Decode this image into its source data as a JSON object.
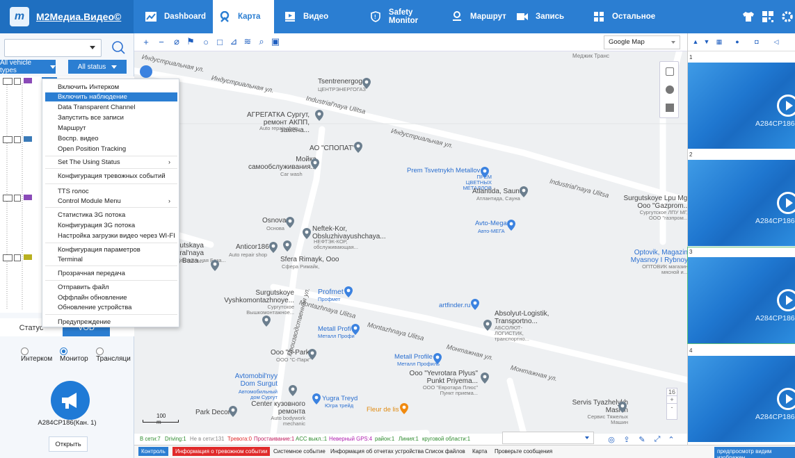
{
  "app": {
    "title": "M2Медиа.Видео©",
    "logo_letter": "m"
  },
  "nav": [
    {
      "label": "Dashboard",
      "icon": "chart-icon"
    },
    {
      "label": "Карта",
      "icon": "map-pin-icon",
      "active": true
    },
    {
      "label": "Видео",
      "icon": "play-icon"
    },
    {
      "label": "Safety Monitor",
      "icon": "shield-icon"
    },
    {
      "label": "Маршрут",
      "icon": "route-icon"
    },
    {
      "label": "Запись",
      "icon": "camera-icon"
    },
    {
      "label": "Остальное",
      "icon": "grid-icon"
    }
  ],
  "colors": {
    "primary": "#2b7ed2",
    "alarm": "#e02a2a",
    "map_bg": "#eef0f2"
  },
  "left": {
    "filter_type": "All vehicle types",
    "filter_status": "All status",
    "tab_status": "Статус",
    "tab_vod": "VOD",
    "radio_intercom": "Интерком",
    "radio_monitor": "Монитор",
    "radio_broadcast": "Трансляци",
    "mic_label": "A284CP186(Кан. 1)",
    "open_button": "Открыть"
  },
  "context_menu": [
    "Включить Интерком",
    "Включить наблюдение",
    "Data Transparent Channel",
    "Запустить все записи",
    "Маршрут",
    "Воспр. видео",
    "Open Position Tracking",
    "Set The Using Status",
    "Конфигурация тревожных событий",
    "TTS голос",
    "Control Module Menu",
    "Статистика 3G потока",
    "Конфигурация 3G потока",
    "Настройка загрузки видео через WI-FI",
    "Конфигурация параметров",
    "Terminal",
    "Прозрачная передача",
    "Отправить файл",
    "Оффлайн обновление",
    "Обновление устройства",
    "Предупреждение"
  ],
  "map": {
    "provider": "Google Map",
    "scale": "100 m",
    "roads": [
      "Индустриальная ул.",
      "Industrial'naya Ulitsa",
      "Индустриальная ул.",
      "Industrial'naya Ulitsa",
      "Монтажная ул.",
      "Montazhnaya Ulitsa",
      "Montazhnaya Ulitsa",
      "Монтажная ул.",
      "Монтажная ул.",
      "Производственная ул."
    ],
    "places": [
      {
        "name": "Tsentrenergogaz",
        "sub": "ЦЕНТРЭНЕРГОГАЗ"
      },
      {
        "name": "АГРЕГАТКА Сургут, ремонт АКПП, замена...",
        "sub": "Auto repair shop"
      },
      {
        "name": "АО \"СПОПАТ\"",
        "sub": ""
      },
      {
        "name": "Мойка самообслуживания...",
        "sub": "Car wash"
      },
      {
        "name": "Prem Tsvetnykh Metallov",
        "sub": "ПРЕМ ЦВЕТНЫХ МЕТАЛЛОВ"
      },
      {
        "name": "Atlantida, Sauna",
        "sub": "Атлантида, Сауна"
      },
      {
        "name": "Surgutskoye Lpu Mg, Ooo \"Gazprom...",
        "sub": "Сургутское ЛПУ МГ, ООО \"газпром..."
      },
      {
        "name": "Osnova",
        "sub": "Основа"
      },
      {
        "name": "Neftek-Kor, Obsluzhivayushchaya...",
        "sub": "НЕФТЭК-КОР, обслуживающая..."
      },
      {
        "name": "Avto-Mega",
        "sub": "Авто-МЕГА"
      },
      {
        "name": "Surgutskaya Tsentral'naya Baza...",
        "sub": "Сургутская Центральная База..."
      },
      {
        "name": "Anticor186",
        "sub": "Auto repair shop"
      },
      {
        "name": "Sfera Rimayk, Ooo",
        "sub": "Сфера Римайк,"
      },
      {
        "name": "Optovik, Magazin Myasnoy I Rybnoy",
        "sub": "ОПТОВИК магазин мясной и..."
      },
      {
        "name": "Profmet",
        "sub": "Профмет"
      },
      {
        "name": "Surgutskoye Vyshkomontazhnoye...",
        "sub": "Сургутское Вышкомонтажное..."
      },
      {
        "name": "artfinder.ru",
        "sub": ""
      },
      {
        "name": "Absolyut-Logistik, Transportno...",
        "sub": "АБСОЛЮТ-ЛОГИСТИК, транспортно..."
      },
      {
        "name": "Metall Profi",
        "sub": "Металл Профи"
      },
      {
        "name": "Ooo \"S-Park\"",
        "sub": "ООО \"С-Парк\""
      },
      {
        "name": "Metall Profile",
        "sub": "Металл Профиль"
      },
      {
        "name": "Ooo \"Yevrotara Plyus\" Punkt Priyema...",
        "sub": "ООО \"Евротара Плюс\" Пункт приема..."
      },
      {
        "name": "Avtomobil'nyy Dom Surgut",
        "sub": "Автомобильный дом Сургут"
      },
      {
        "name": "Yugra Treyd",
        "sub": "Югра трейд"
      },
      {
        "name": "Fleur de lis",
        "sub": ""
      },
      {
        "name": "Center кузовного ремонта",
        "sub": "Auto bodywork mechanic"
      },
      {
        "name": "Park Decor",
        "sub": ""
      },
      {
        "name": "Servis Tyazhelykh Mashin",
        "sub": "Сервис Тяжелых Машин"
      },
      {
        "name": "Меджик Транс",
        "sub": ""
      }
    ],
    "zoom_level": "16"
  },
  "status": [
    {
      "text": "В сети:7",
      "color": "#2e8b2e"
    },
    {
      "text": "Driving:1",
      "color": "#2e8b2e"
    },
    {
      "text": "Не в сети:131",
      "color": "#888"
    },
    {
      "text": "Тревога:0",
      "color": "#e02a2a"
    },
    {
      "text": "Простаивание:1",
      "color": "#c02060"
    },
    {
      "text": "ACC выкл.:1",
      "color": "#2e8b2e"
    },
    {
      "text": "Неверный GPS:4",
      "color": "#b020b0"
    },
    {
      "text": "район:1",
      "color": "#2e8b2e"
    },
    {
      "text": "Линия:1",
      "color": "#2e8b2e"
    },
    {
      "text": "круговой области:1",
      "color": "#2e8b2e"
    }
  ],
  "bottom_tabs": [
    "Контроль",
    "Информация о тревожном событии",
    "Системное событие",
    "Информация об отчетах устройства",
    "Список файлов",
    "Карта",
    "Проверьте сообщения",
    "предпросмотр видим изображен"
  ],
  "video": [
    {
      "num": "1",
      "plate": "A284CP186"
    },
    {
      "num": "2",
      "plate": "A284CP186"
    },
    {
      "num": "3",
      "plate": "A284CP186"
    },
    {
      "num": "4",
      "plate": "A284CP186"
    }
  ]
}
